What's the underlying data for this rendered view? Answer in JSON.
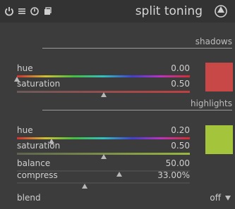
{
  "module": {
    "title": "split toning",
    "icons": [
      "power-icon",
      "presets-menu-icon",
      "reset-icon",
      "multi-instance-icon",
      "preset-icon"
    ]
  },
  "shadows": {
    "label": "shadows",
    "hue": {
      "label": "hue",
      "value": "0.00",
      "fraction": 0.0
    },
    "saturation": {
      "label": "saturation",
      "value": "0.50",
      "fraction": 0.5
    },
    "color": "#c84848"
  },
  "highlights": {
    "label": "highlights",
    "hue": {
      "label": "hue",
      "value": "0.20",
      "fraction": 0.2
    },
    "saturation": {
      "label": "saturation",
      "value": "0.50",
      "fraction": 0.5
    },
    "color": "#a4c43c"
  },
  "balance": {
    "label": "balance",
    "value": "50.00",
    "fraction": 0.59
  },
  "compress": {
    "label": "compress",
    "value": "33.00%",
    "fraction": 0.39
  },
  "blend": {
    "label": "blend",
    "value": "off"
  }
}
